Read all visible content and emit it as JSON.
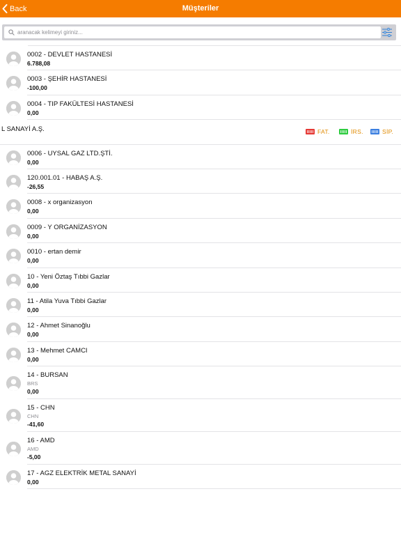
{
  "header": {
    "back_label": "Back",
    "title": "Müşteriler"
  },
  "search": {
    "placeholder": "aranacak kelimeyi giriniz..."
  },
  "swipe_actions": [
    {
      "label": "FAT.",
      "color": "#e53935",
      "icon": "invoice-icon"
    },
    {
      "label": "İRS.",
      "color": "#2ecc40",
      "icon": "waybill-icon"
    },
    {
      "label": "SİP.",
      "color": "#3b7fe0",
      "icon": "order-icon"
    }
  ],
  "accent_color": "#f57c00",
  "customers": [
    {
      "title": "0002 - DEVLET HASTANESİ",
      "sub": "",
      "balance": "6.788,08"
    },
    {
      "title": "0003 - ŞEHİR HASTANESİ",
      "sub": "",
      "balance": "-100,00"
    },
    {
      "title": "0004 - TIP FAKÜLTESİ HASTANESİ",
      "sub": "",
      "balance": "0,00"
    },
    {
      "title": "L SANAYİ A.Ş.",
      "sub": "",
      "balance": ""
    },
    {
      "title": "0006 - UYSAL GAZ LTD.ŞTİ.",
      "sub": "",
      "balance": "0,00"
    },
    {
      "title": "120.001.01 - HABAŞ A.Ş.",
      "sub": "",
      "balance": "-26,55"
    },
    {
      "title": "0008 - x organizasyon",
      "sub": "",
      "balance": "0,00"
    },
    {
      "title": "0009 - Y ORGANİZASYON",
      "sub": "",
      "balance": "0,00"
    },
    {
      "title": "0010 - ertan demir",
      "sub": "",
      "balance": "0,00"
    },
    {
      "title": "10 - Yeni Öztaş Tıbbi Gazlar",
      "sub": "",
      "balance": "0,00"
    },
    {
      "title": "11 - Atila Yuva Tıbbi Gazlar",
      "sub": "",
      "balance": "0,00"
    },
    {
      "title": "12 - Ahmet Sinanoğlu",
      "sub": "",
      "balance": "0,00"
    },
    {
      "title": "13 - Mehmet CAMCI",
      "sub": "",
      "balance": "0,00"
    },
    {
      "title": "14 - BURSAN",
      "sub": "BRS",
      "balance": "0,00"
    },
    {
      "title": "15 - CHN",
      "sub": "CHN",
      "balance": "-41,60"
    },
    {
      "title": "16 - AMD",
      "sub": "AMD",
      "balance": "-5,00"
    },
    {
      "title": "17 - AGZ ELEKTRİK METAL SANAYİ",
      "sub": "",
      "balance": "0,00"
    }
  ]
}
